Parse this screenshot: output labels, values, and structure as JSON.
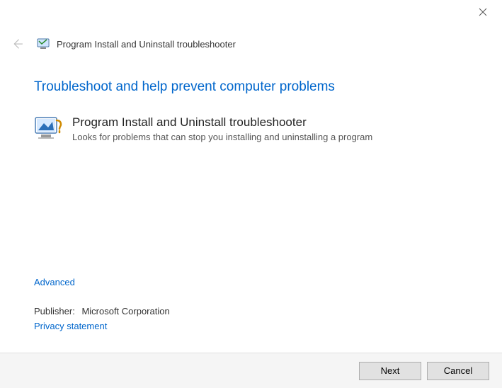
{
  "window": {
    "title": "Program Install and Uninstall troubleshooter"
  },
  "main": {
    "heading": "Troubleshoot and help prevent computer problems",
    "troubleshooter": {
      "title": "Program Install and Uninstall troubleshooter",
      "description": "Looks for problems that can stop you installing and uninstalling a program"
    }
  },
  "links": {
    "advanced": "Advanced",
    "privacy": "Privacy statement"
  },
  "publisher": {
    "label": "Publisher:",
    "name": "Microsoft Corporation"
  },
  "buttons": {
    "next": "Next",
    "cancel": "Cancel"
  }
}
